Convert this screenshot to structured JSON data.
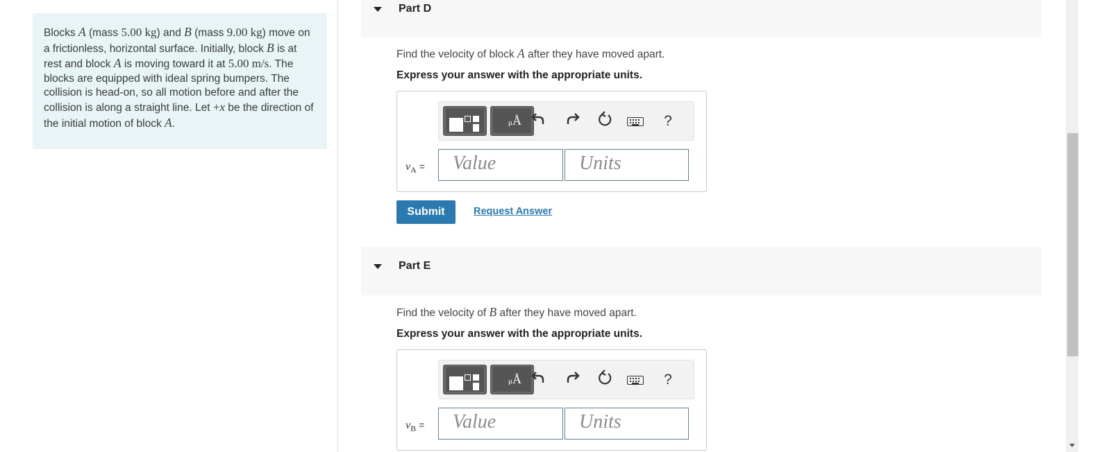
{
  "problem": {
    "text_html": "Blocks <span class=\"mi\">A</span> (mass <span class=\"m\">5.00 kg</span>) and <span class=\"mi\">B</span> (mass <span class=\"m\">9.00 kg</span>) move on a frictionless, horizontal surface. Initially, block <span class=\"mi\">B</span> is at rest and block <span class=\"mi\">A</span> is moving toward it at <span class=\"m\">5.00 m/s</span>. The blocks are equipped with ideal spring bumpers. The collision is head-on, so all motion before and after the collision is along a straight line. Let <span class=\"m\">+<i>x</i></span> be the direction of the initial motion of block <span class=\"mi\">A</span>."
  },
  "parts": [
    {
      "title": "Part D",
      "prompt_html": "Find the velocity of block <span class=\"mi\">A</span> after they have moved apart.",
      "instruction": "Express your answer with the appropriate units.",
      "var_symbol": "v",
      "var_sub": "A",
      "equals": "=",
      "value_placeholder": "Value",
      "units_placeholder": "Units",
      "submit_label": "Submit",
      "request_label": "Request Answer"
    },
    {
      "title": "Part E",
      "prompt_html": "Find the velocity of <span class=\"mi\">B</span> after they have moved apart.",
      "instruction": "Express your answer with the appropriate units.",
      "var_symbol": "v",
      "var_sub": "B",
      "equals": "=",
      "value_placeholder": "Value",
      "units_placeholder": "Units"
    }
  ],
  "toolbar": {
    "units_button_glyph": "Å",
    "units_button_prefix": "μ",
    "help_label": "?",
    "icons": [
      "templates-icon",
      "units-icon",
      "undo-icon",
      "redo-icon",
      "reset-icon",
      "keyboard-icon",
      "help-icon"
    ]
  },
  "colors": {
    "problem_bg": "#e8f4f5",
    "part_header_bg": "#f7f7f7",
    "submit_bg": "#2a7ab0",
    "link": "#2a7ab0",
    "field_border": "#5b7f96"
  }
}
